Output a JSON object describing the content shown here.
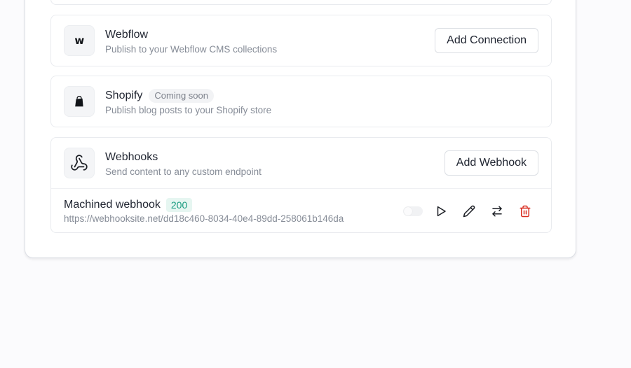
{
  "integrations": {
    "webflow": {
      "name": "Webflow",
      "description": "Publish to your Webflow CMS collections",
      "icon_glyph": "w",
      "icon": "webflow-logo-icon",
      "action_label": "Add Connection"
    },
    "shopify": {
      "name": "Shopify",
      "badge": "Coming soon",
      "description": "Publish blog posts to your Shopify store",
      "icon": "shopify-bag-icon"
    },
    "webhooks": {
      "name": "Webhooks",
      "description": "Send content to any custom endpoint",
      "icon": "webhook-icon",
      "action_label": "Add Webhook",
      "items": [
        {
          "name": "Machined webhook",
          "status": "200",
          "url": "https://webhooksite.net/dd18c460-8034-40e4-89dd-258061b146da",
          "enabled": false,
          "actions": [
            "play-icon",
            "pencil-icon",
            "swap-arrows-icon",
            "trash-icon"
          ]
        }
      ]
    }
  },
  "colors": {
    "page_background": "#fbfbfd",
    "status_success_text": "#169a7e",
    "status_success_bg": "#e6f6f1",
    "delete_red": "#d92d20"
  }
}
